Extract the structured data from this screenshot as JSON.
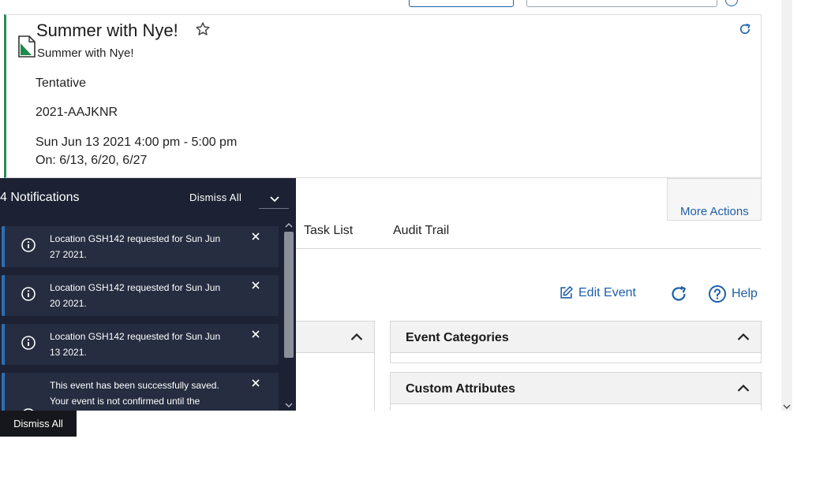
{
  "colors": {
    "accent": "#1e5fa8",
    "status_bar": "#2e8b57",
    "notification_bg": "#1c2233",
    "notification_item_bg": "#262d40"
  },
  "event": {
    "title": "Summer with Nye!",
    "subtitle": "Summer with Nye!",
    "state": "Tentative",
    "reference": "2021-AAJKNR",
    "datetime": "Sun Jun 13 2021 4:00 pm - 5:00 pm",
    "occurrences": "On: 6/13, 6/20, 6/27"
  },
  "actions": {
    "more_actions": "More Actions"
  },
  "tabs": [
    {
      "label": "Task List"
    },
    {
      "label": "Audit Trail"
    }
  ],
  "toolbar": {
    "edit_event": "Edit Event",
    "help": "Help"
  },
  "panels": {
    "event_categories": "Event Categories",
    "custom_attributes": "Custom Attributes"
  },
  "notifications": {
    "title": "4 Notifications",
    "dismiss_all": "Dismiss All",
    "items": [
      {
        "text": "Location GSH142 requested for Sun Jun 27 2021."
      },
      {
        "text": "Location GSH142 requested for Sun Jun 20 2021."
      },
      {
        "text": "Location GSH142 requested for Sun Jun 13 2021."
      },
      {
        "text": "This event has been successfully saved. Your event is not confirmed until the"
      }
    ]
  },
  "footer": {
    "dismiss_all": "Dismiss All"
  }
}
